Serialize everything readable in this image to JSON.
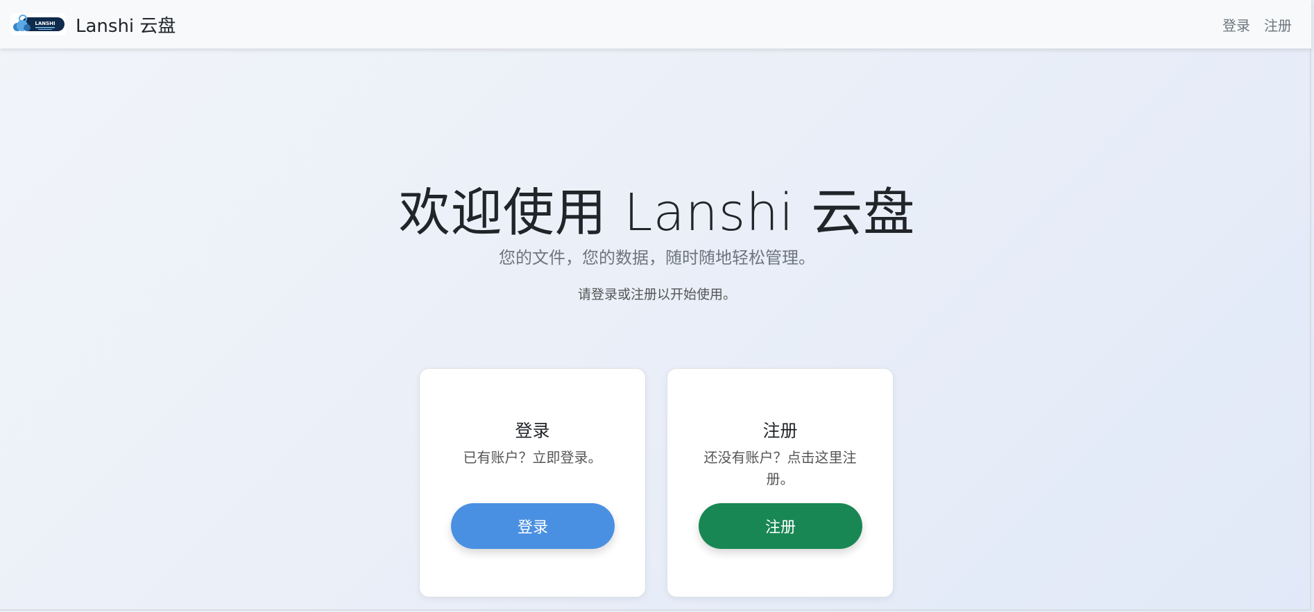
{
  "navbar": {
    "logo_text": "LANSHI",
    "brand": "Lanshi 云盘",
    "links": {
      "login": "登录",
      "register": "注册"
    }
  },
  "hero": {
    "title": "欢迎使用 Lanshi 云盘",
    "lead": "您的文件，您的数据，随时随地轻松管理。",
    "prompt": "请登录或注册以开始使用。"
  },
  "cards": {
    "login": {
      "title": "登录",
      "text": "已有账户？立即登录。",
      "button": "登录",
      "color": "#4a90e2"
    },
    "register": {
      "title": "注册",
      "text": "还没有账户？点击这里注册。",
      "button": "注册",
      "color": "#198754"
    }
  }
}
